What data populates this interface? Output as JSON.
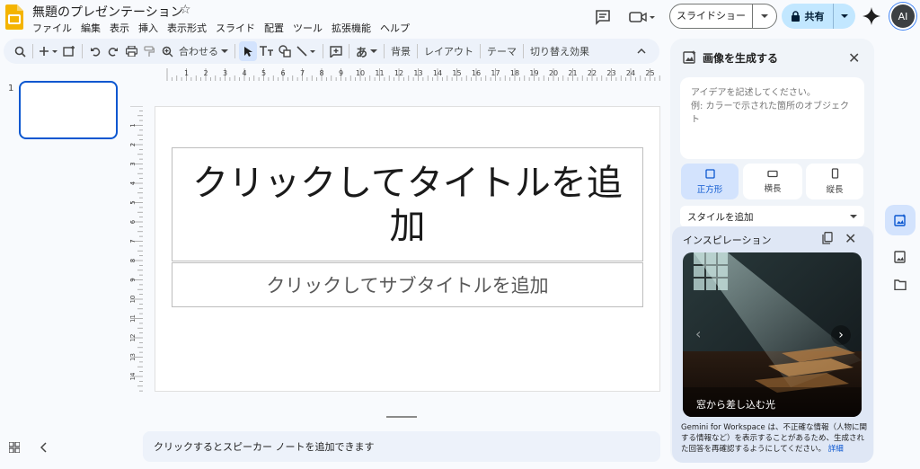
{
  "header": {
    "doc_title": "無題のプレゼンテーション",
    "menu": [
      "ファイル",
      "編集",
      "表示",
      "挿入",
      "表示形式",
      "スライド",
      "配置",
      "ツール",
      "拡張機能",
      "ヘルプ"
    ],
    "slideshow_label": "スライドショー",
    "share_label": "共有",
    "avatar_initials": "AI"
  },
  "toolbar": {
    "zoom_label": "合わせる",
    "background_label": "背景",
    "layout_label": "レイアウト",
    "theme_label": "テーマ",
    "transition_label": "切り替え効果",
    "ime_label": "あ"
  },
  "filmstrip": {
    "slide_number": "1"
  },
  "ruler": {
    "top_ticks": [
      "1",
      "2",
      "3",
      "4",
      "5",
      "6",
      "7",
      "8",
      "9",
      "10",
      "11",
      "12",
      "13",
      "14",
      "15",
      "16",
      "17",
      "18",
      "19",
      "20",
      "21",
      "22",
      "23",
      "24",
      "25"
    ],
    "left_ticks": [
      "1",
      "2",
      "3",
      "4",
      "5",
      "6",
      "7",
      "8",
      "9",
      "10",
      "11",
      "12",
      "13",
      "14"
    ]
  },
  "slide": {
    "title_placeholder": "クリックしてタイトルを追加",
    "subtitle_placeholder": "クリックしてサブタイトルを追加"
  },
  "notes": {
    "placeholder": "クリックするとスピーカー ノートを追加できます"
  },
  "panel": {
    "title": "画像を生成する",
    "prompt_placeholder": "アイデアを記述してください。\n例: カラーで示された箇所のオブジェクト",
    "aspects": [
      {
        "label": "正方形",
        "selected": true
      },
      {
        "label": "横長",
        "selected": false
      },
      {
        "label": "縦長",
        "selected": false
      }
    ],
    "style_label": "スタイルを追加",
    "inspiration": {
      "title": "インスピレーション",
      "caption": "窓から差し込む光"
    },
    "disclaimer": "Gemini for Workspace は、不正確な情報（人物に関する情報など）を表示することがあるため、生成された回答を再確認するようにしてください。",
    "details_link": "詳細"
  },
  "colors": {
    "accent": "#0b57d0",
    "share_bg": "#c2e7ff",
    "toolbar_bg": "#edf2fa",
    "panel_bg": "#f0f4f9"
  }
}
